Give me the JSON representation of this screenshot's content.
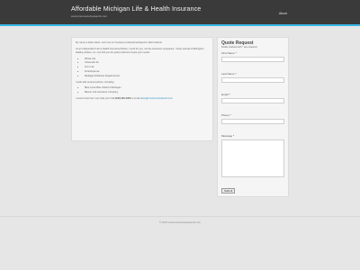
{
  "header": {
    "title": "Affordable Michigan Life & Health Insurance",
    "subtitle": "www.insurancebydeanhi.com",
    "nav_about": "About"
  },
  "content": {
    "intro": "My name is Dean Heinz, and I am an Insurance professional based in Metro Detroit.",
    "agent_text": "As an Independent Life & Health Insurance Broker, I work for you, not the insurance companies. I shop several of Michigan's leading carriers, so I can find you the policy that best meets your needs:",
    "products": [
      "Whole Life",
      "Universal Life",
      "Term Life",
      "Final Expense",
      "Medigap (Medicare Supplements)"
    ],
    "carriers_text": "I work with several carriers, including:",
    "carriers": [
      "Blue Cross Blue Shield of Michigan",
      "Banner Life Insurance Company"
    ],
    "contact_prefix": "I never know how I can help you! Call ",
    "contact_phone": "(248) 990-3966",
    "contact_middle": " or email ",
    "contact_email": "dean@insurancebydeanhi.com"
  },
  "quote_form": {
    "title": "Quote Request",
    "note": "Fields marked with * are required",
    "first_name_label": "First Name",
    "last_name_label": "Last Name",
    "email_label": "Email",
    "phone_label": "Phone",
    "message_label": "Message",
    "required_mark": "*",
    "first_name_value": "",
    "last_name_value": "",
    "email_value": "",
    "phone_value": "",
    "message_value": "",
    "submit_label": "Submit"
  },
  "footer": {
    "copyright": "© 2015 www.insurancebydeanhi.com"
  },
  "colors": {
    "header_bg": "#3a3a3a",
    "accent": "#3bb7e6",
    "link": "#3b8fc3",
    "required": "#cc0000"
  }
}
